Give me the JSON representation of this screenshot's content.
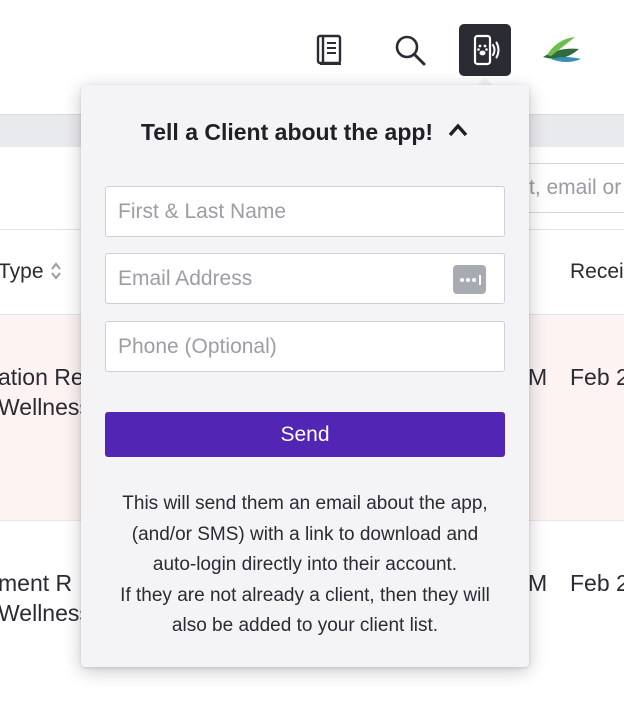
{
  "toolbar": {
    "icons": [
      "book-icon",
      "search-icon",
      "pet-app-icon",
      "brand-logo-icon",
      "wallet-icon"
    ],
    "accent": "#2a2b33"
  },
  "background": {
    "search_placeholder": "t, email or",
    "table": {
      "headers": {
        "type": "Type",
        "received": "Recei"
      },
      "rows": [
        {
          "type_line1": "ation Re",
          "type_line2": "Wellness",
          "time": "M",
          "date": "Feb 2"
        },
        {
          "type_line1": "ment R",
          "type_line2": "Wellness",
          "time": "M",
          "date": "Feb 2"
        }
      ]
    },
    "row_highlight": "#fcf3f2"
  },
  "popover": {
    "title": "Tell a Client about the app!",
    "fields": {
      "name_placeholder": "First & Last Name",
      "email_placeholder": "Email Address",
      "phone_placeholder": "Phone (Optional)"
    },
    "send_label": "Send",
    "send_color": "#5325b5",
    "info_lines": [
      "This will send them an email about the app,",
      "(and/or SMS) with a link to download and",
      "auto-login directly into their account.",
      "If they are not already a client, then they will",
      "also be added to your client list."
    ]
  }
}
